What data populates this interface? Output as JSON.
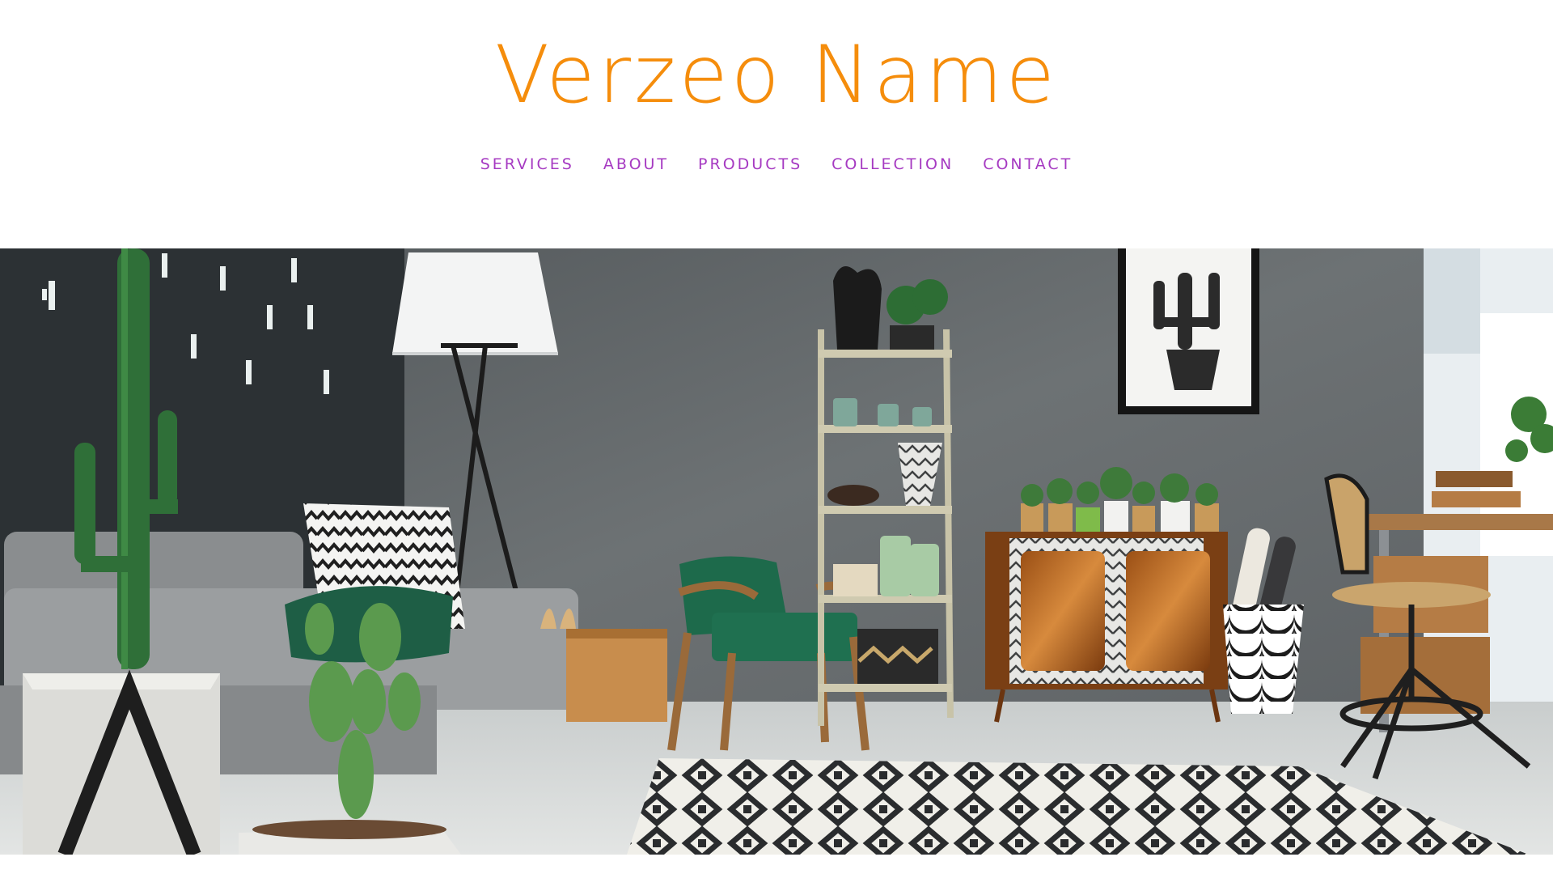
{
  "header": {
    "brand": "Verzeo Name",
    "brand_color": "#f58d0c",
    "nav_color": "#a63ac2"
  },
  "nav": {
    "items": [
      {
        "label": "SERVICES"
      },
      {
        "label": "ABOUT"
      },
      {
        "label": "PRODUCTS"
      },
      {
        "label": "COLLECTION"
      },
      {
        "label": "CONTACT"
      }
    ]
  },
  "hero": {
    "image_subject": "interior-room-photo"
  }
}
